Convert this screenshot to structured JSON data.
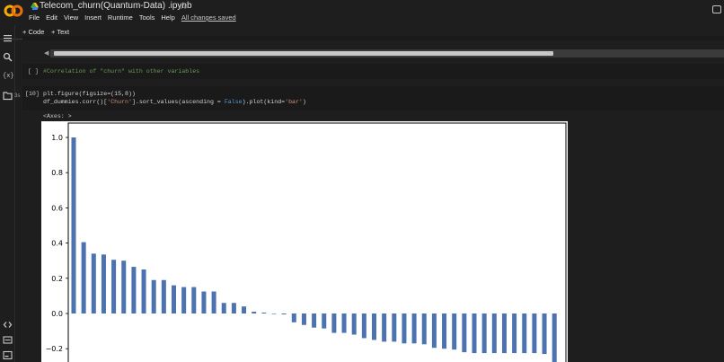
{
  "header": {
    "title": "Telecom_churn(Quantum-Data) .ipynb",
    "menu": [
      "File",
      "Edit",
      "View",
      "Insert",
      "Runtime",
      "Tools",
      "Help"
    ],
    "saved_status": "All changes saved"
  },
  "toolbar": {
    "code_label": "+ Code",
    "text_label": "+ Text"
  },
  "rail": {
    "icons": [
      "menu-icon",
      "search-icon",
      "variables-icon",
      "folder-icon",
      "code-snippets-icon",
      "command-palette-icon",
      "terminal-icon"
    ],
    "variables_glyph": "{x}"
  },
  "cells": {
    "comment_prompt": "[ ]",
    "comment_code": "#Correlation of \"churn\" with other variables",
    "plot_prompt": "[10]",
    "plot_line1": "plt.figure(figsize=(15,8))",
    "plot_line2_a": "df_dummies.corr()[",
    "plot_line2_str": "'Churn'",
    "plot_line2_b": "].sort_values(ascending = ",
    "plot_line2_kw": "False",
    "plot_line2_c": ").plot(kind=",
    "plot_line2_str2": "'bar'",
    "plot_line2_d": ")",
    "output_label": "<Axes: >",
    "run_time": "3s"
  },
  "colors": {
    "bar": "#4c72b0",
    "background": "#1e1e1e",
    "cell": "#1a1a1a"
  },
  "chart_data": {
    "type": "bar",
    "title": "",
    "xlabel": "",
    "ylabel": "",
    "yticks": [
      "1.0",
      "0.8",
      "0.6",
      "0.4",
      "0.2",
      "0.0",
      "−0.2"
    ],
    "ylim": [
      -0.28,
      1.04
    ],
    "grid": false,
    "values": [
      1.0,
      0.405,
      0.34,
      0.335,
      0.305,
      0.3,
      0.265,
      0.25,
      0.19,
      0.19,
      0.16,
      0.15,
      0.15,
      0.125,
      0.125,
      0.06,
      0.06,
      0.04,
      0.01,
      0.005,
      0.0,
      -0.005,
      -0.05,
      -0.065,
      -0.08,
      -0.085,
      -0.11,
      -0.11,
      -0.12,
      -0.14,
      -0.15,
      -0.16,
      -0.16,
      -0.17,
      -0.17,
      -0.175,
      -0.195,
      -0.2,
      -0.205,
      -0.22,
      -0.225,
      -0.225,
      -0.225,
      -0.225,
      -0.225,
      -0.225,
      -0.225,
      -0.23,
      -0.28
    ]
  }
}
